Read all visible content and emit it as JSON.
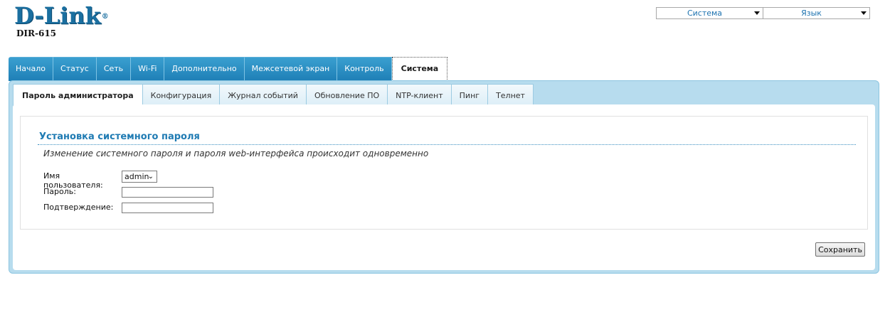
{
  "header": {
    "logo_text": "D-Link",
    "logo_mark": "®",
    "model": "DIR-615",
    "system_select": "Система",
    "language_select": "Язык"
  },
  "main_tabs": [
    {
      "label": "Начало"
    },
    {
      "label": "Статус"
    },
    {
      "label": "Сеть"
    },
    {
      "label": "Wi-Fi"
    },
    {
      "label": "Дополнительно"
    },
    {
      "label": "Межсетевой экран"
    },
    {
      "label": "Контроль"
    },
    {
      "label": "Система",
      "active": true
    }
  ],
  "sub_tabs": [
    {
      "label": "Пароль администратора",
      "active": true
    },
    {
      "label": "Конфигурация"
    },
    {
      "label": "Журнал событий"
    },
    {
      "label": "Обновление ПО"
    },
    {
      "label": "NTP-клиент"
    },
    {
      "label": "Пинг"
    },
    {
      "label": "Телнет"
    }
  ],
  "form": {
    "title": "Установка системного пароля",
    "description": "Изменение системного пароля и пароля web-интерфейса происходит одновременно",
    "username_label": "Имя пользователя:",
    "username_value": "admin",
    "password_label": "Пароль:",
    "password_value": "",
    "confirm_label": "Подтверждение:",
    "confirm_value": ""
  },
  "actions": {
    "save_label": "Сохранить"
  },
  "colors": {
    "brand": "#1a6fa0",
    "tab_bg": "#1e7fb6",
    "panel_bg": "#b7dcee",
    "title": "#1f7bb3"
  }
}
